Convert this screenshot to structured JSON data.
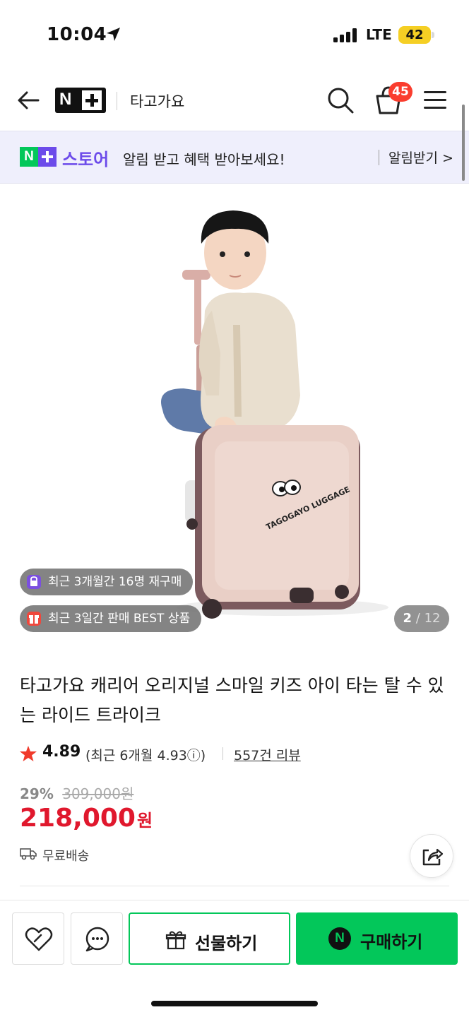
{
  "status_bar": {
    "time": "10:04",
    "network": "LTE",
    "battery": "42"
  },
  "header": {
    "store_name": "타고가요",
    "cart_count": "45"
  },
  "banner": {
    "brand": "스토어",
    "message": "알림 받고 혜택 받아보세요!",
    "action": "알림받기 >"
  },
  "hero": {
    "badges": [
      {
        "text": "최근 3개월간 16명 재구매",
        "icon": "repurchase-bag-icon",
        "color": "#7b4fe0"
      },
      {
        "text": "최근 3일간 판매 BEST 상품",
        "icon": "gift-box-icon",
        "color": "#f0473c"
      }
    ],
    "counter_current": "2",
    "counter_total": "12",
    "luggage_text": "TAGOGAYO LUGGAGE"
  },
  "product": {
    "title": "타고가요 캐리어 오리지널 스마일 키즈 아이 타는 탈 수 있는 라이드 트라이크",
    "rating": "4.89",
    "recent_rating": "(최근 6개월 4.93ⓘ)",
    "review_link": "557건 리뷰",
    "discount": "29%",
    "original_price": "309,000원",
    "price": "218,000",
    "currency": "원",
    "shipping": "무료배송"
  },
  "bottom_bar": {
    "gift_label": "선물하기",
    "buy_label": "구매하기",
    "buy_badge": "N"
  },
  "colors": {
    "naver_green": "#03c75a",
    "store_purple": "#6c4bea",
    "price_red": "#e0182d",
    "badge_red": "#fa3d2e"
  }
}
